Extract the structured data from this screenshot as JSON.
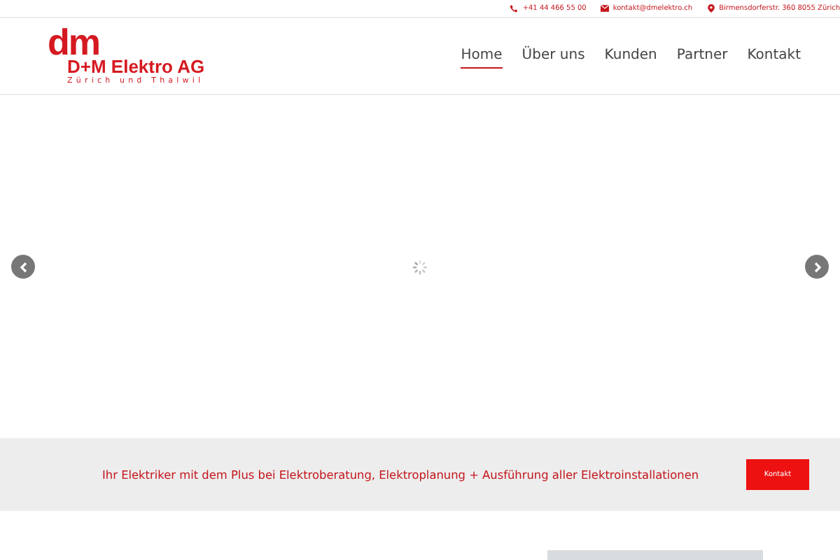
{
  "topbar": {
    "phone": "+41 44 466 55 00",
    "email": "kontakt@dmelektro.ch",
    "address": "Birmensdorferstr. 360 8055 Zürich"
  },
  "logo": {
    "mark": "dm",
    "name": "D+M Elektro AG",
    "tagline": "Zürich und Thalwil"
  },
  "nav": [
    {
      "label": "Home",
      "selected": true
    },
    {
      "label": "Über uns",
      "selected": false
    },
    {
      "label": "Kunden",
      "selected": false
    },
    {
      "label": "Partner",
      "selected": false
    },
    {
      "label": "Kontakt",
      "selected": false
    }
  ],
  "banner": {
    "text": "Ihr Elektriker mit dem Plus bei Elektroberatung, Elektroplanung + Ausführung aller Elektroinstallationen",
    "button": "Kontakt"
  }
}
